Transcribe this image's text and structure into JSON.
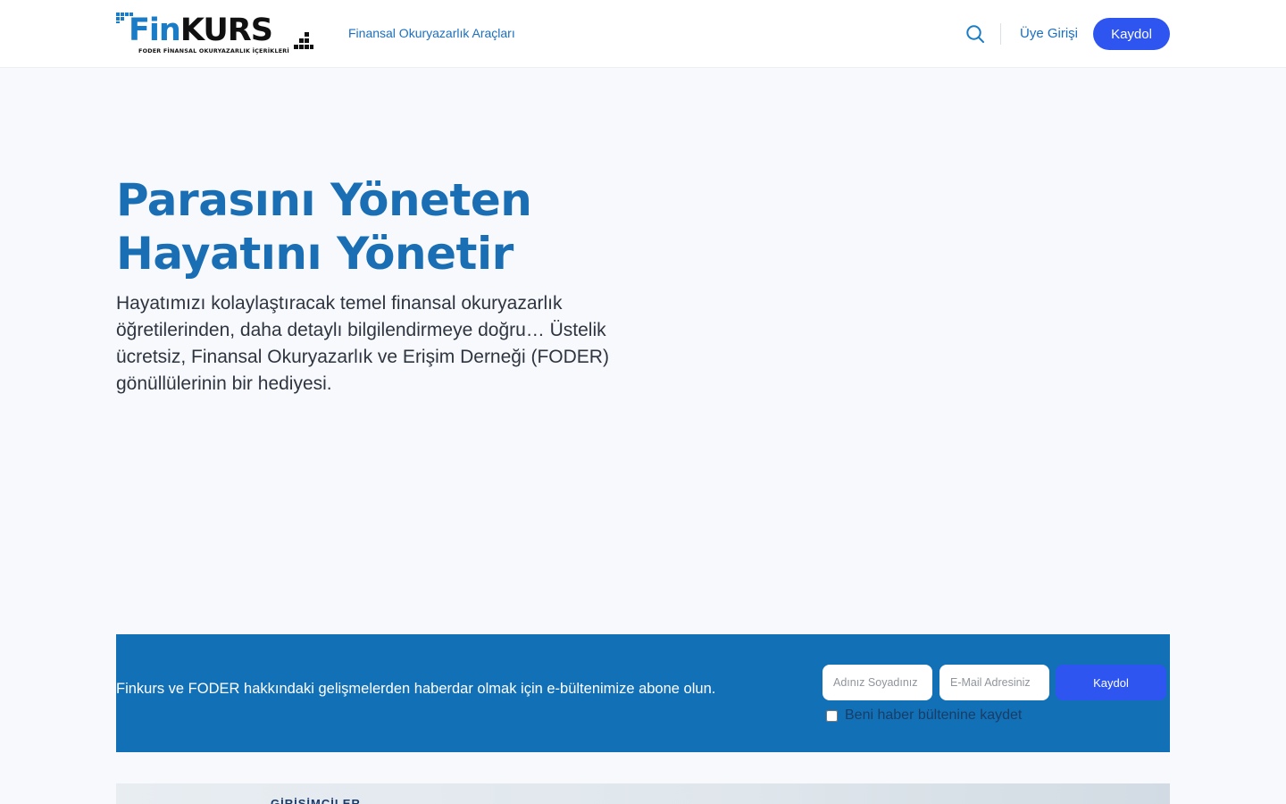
{
  "brand": {
    "logo_fin": "Fin",
    "logo_kurs": "KURS",
    "logo_tagline": "FODER FİNANSAL OKURYAZARLIK İÇERİKLERİ",
    "primary_color": "#1a6fb4",
    "accent_color": "#2e55f0"
  },
  "header": {
    "nav_link": "Finansal Okuryazarlık Araçları",
    "search_icon": "search-icon",
    "login_label": "Üye Girişi",
    "signup_label": "Kaydol"
  },
  "hero": {
    "title_line1": "Parasını Yöneten",
    "title_line2": "Hayatını Yönetir",
    "description": "Hayatımızı kolaylaştıracak temel finansal okuryazarlık öğretilerinden, daha detaylı bilgilendirmeye doğru… Üstelik ücretsiz, Finansal Okuryazarlık ve Erişim Derneği (FODER) gönüllülerinin bir hediyesi."
  },
  "newsletter": {
    "text": "Finkurs ve FODER hakkındaki gelişmelerden haberdar olmak için e-bültenimize abone olun.",
    "name_placeholder": "Adınız Soyadınız",
    "email_placeholder": "E-Mail Adresiniz",
    "submit_label": "Kaydol",
    "checkbox_label": "Beni haber bültenine kaydet",
    "background_color": "#1270b6"
  },
  "bottom": {
    "partial_text": "GİRİŞİMCİLER"
  }
}
